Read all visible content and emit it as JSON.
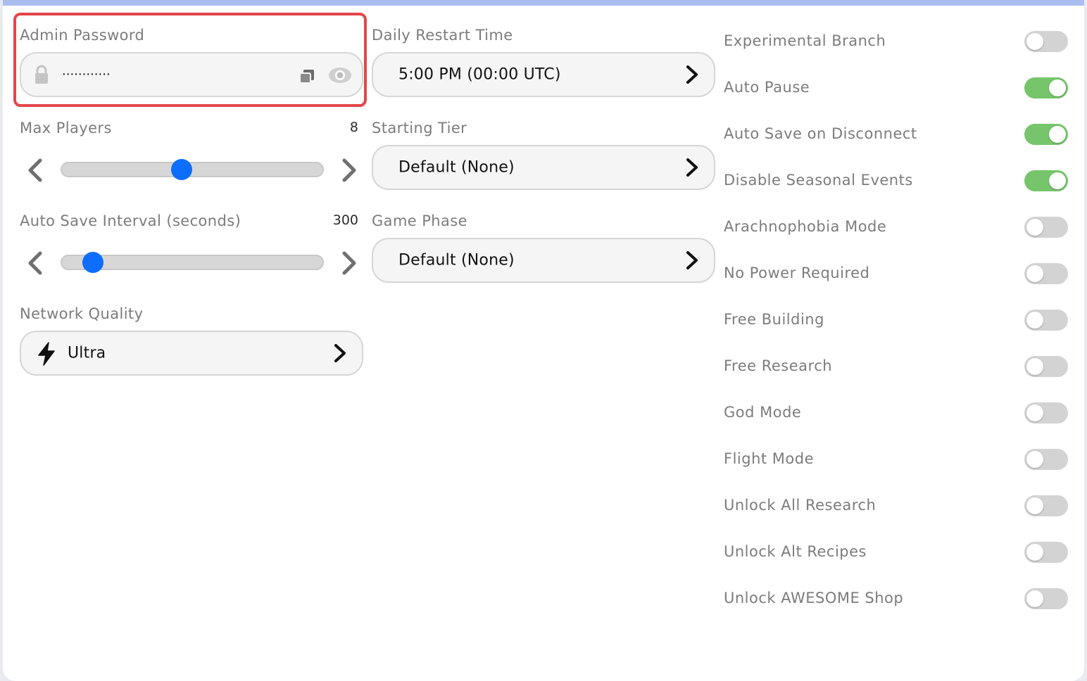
{
  "admin_password": {
    "label": "Admin Password",
    "value": "············",
    "icons": [
      "lock-icon",
      "copy-icon",
      "eye-icon"
    ]
  },
  "daily_restart": {
    "label": "Daily Restart Time",
    "value": "5:00 PM (00:00 UTC)"
  },
  "max_players": {
    "label": "Max Players",
    "value": "8",
    "slider_fraction": 0.46
  },
  "starting_tier": {
    "label": "Starting Tier",
    "value": "Default (None)"
  },
  "auto_save_interval": {
    "label": "Auto Save Interval (seconds)",
    "value": "300",
    "slider_fraction": 0.12
  },
  "game_phase": {
    "label": "Game Phase",
    "value": "Default (None)"
  },
  "network_quality": {
    "label": "Network Quality",
    "value": "Ultra",
    "icon": "lightning-icon"
  },
  "colors": {
    "accent": "#0d6efd",
    "toggle_on": "#76c56b",
    "toggle_off": "#d3d3d3",
    "highlight": "#e3464b"
  },
  "toggles": [
    {
      "label": "Experimental Branch",
      "on": false
    },
    {
      "label": "Auto Pause",
      "on": true
    },
    {
      "label": "Auto Save on Disconnect",
      "on": true
    },
    {
      "label": "Disable Seasonal Events",
      "on": true
    },
    {
      "label": "Arachnophobia Mode",
      "on": false
    },
    {
      "label": "No Power Required",
      "on": false
    },
    {
      "label": "Free Building",
      "on": false
    },
    {
      "label": "Free Research",
      "on": false
    },
    {
      "label": "God Mode",
      "on": false
    },
    {
      "label": "Flight Mode",
      "on": false
    },
    {
      "label": "Unlock All Research",
      "on": false
    },
    {
      "label": "Unlock Alt Recipes",
      "on": false
    },
    {
      "label": "Unlock AWESOME Shop",
      "on": false
    }
  ]
}
